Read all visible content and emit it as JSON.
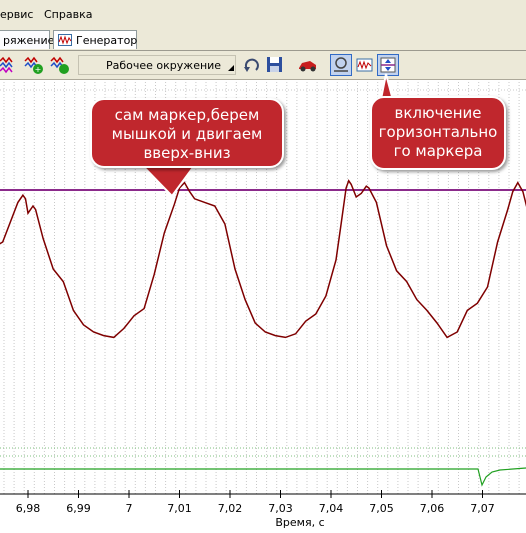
{
  "menu": {
    "items": [
      "ервис",
      "Справка"
    ]
  },
  "tabs": [
    {
      "label": "ряжение"
    },
    {
      "label": "Генератор"
    }
  ],
  "toolbar": {
    "environment_select": "Рабочее окружение",
    "icons": [
      "multiwave-red-icon",
      "multiwave-green-icon",
      "multiwave-green-icon",
      "dropdown-arrow-icon",
      "undo-icon",
      "save-icon",
      "car-icon",
      "reset-view-icon",
      "waveform-view-icon",
      "horizontal-marker-icon"
    ]
  },
  "chart_data": {
    "type": "line",
    "x_tick_labels": [
      "6,98",
      "6,99",
      "7",
      "7,01",
      "7,02",
      "7,03",
      "7,04",
      "7,05",
      "7,06",
      "7,07",
      "7"
    ],
    "xlabel": "Время, с",
    "horizontal_marker": true,
    "series": [
      {
        "color": "#7f0000",
        "points": [
          [
            6.972,
            0.55
          ],
          [
            6.975,
            0.6
          ],
          [
            6.978,
            0.82
          ],
          [
            6.979,
            0.86
          ],
          [
            6.9795,
            0.84
          ],
          [
            6.98,
            0.76
          ],
          [
            6.981,
            0.8
          ],
          [
            6.9815,
            0.78
          ],
          [
            6.983,
            0.62
          ],
          [
            6.985,
            0.45
          ],
          [
            6.987,
            0.38
          ],
          [
            6.989,
            0.22
          ],
          [
            6.991,
            0.14
          ],
          [
            6.993,
            0.1
          ],
          [
            6.995,
            0.08
          ],
          [
            6.997,
            0.07
          ],
          [
            6.999,
            0.12
          ],
          [
            7.001,
            0.19
          ],
          [
            7.003,
            0.23
          ],
          [
            7.005,
            0.42
          ],
          [
            7.007,
            0.65
          ],
          [
            7.009,
            0.81
          ],
          [
            7.01,
            0.9
          ],
          [
            7.011,
            0.93
          ],
          [
            7.012,
            0.88
          ],
          [
            7.013,
            0.84
          ],
          [
            7.015,
            0.82
          ],
          [
            7.017,
            0.8
          ],
          [
            7.019,
            0.7
          ],
          [
            7.021,
            0.45
          ],
          [
            7.023,
            0.28
          ],
          [
            7.025,
            0.15
          ],
          [
            7.027,
            0.1
          ],
          [
            7.029,
            0.08
          ],
          [
            7.031,
            0.07
          ],
          [
            7.033,
            0.09
          ],
          [
            7.035,
            0.16
          ],
          [
            7.037,
            0.2
          ],
          [
            7.039,
            0.3
          ],
          [
            7.041,
            0.5
          ],
          [
            7.042,
            0.7
          ],
          [
            7.043,
            0.9
          ],
          [
            7.0435,
            0.94
          ],
          [
            7.044,
            0.92
          ],
          [
            7.045,
            0.85
          ],
          [
            7.046,
            0.87
          ],
          [
            7.047,
            0.91
          ],
          [
            7.0475,
            0.9
          ],
          [
            7.049,
            0.82
          ],
          [
            7.051,
            0.58
          ],
          [
            7.053,
            0.44
          ],
          [
            7.055,
            0.38
          ],
          [
            7.057,
            0.28
          ],
          [
            7.059,
            0.22
          ],
          [
            7.061,
            0.15
          ],
          [
            7.063,
            0.07
          ],
          [
            7.065,
            0.1
          ],
          [
            7.067,
            0.22
          ],
          [
            7.069,
            0.26
          ],
          [
            7.071,
            0.35
          ],
          [
            7.073,
            0.6
          ],
          [
            7.075,
            0.78
          ],
          [
            7.076,
            0.88
          ],
          [
            7.077,
            0.93
          ],
          [
            7.078,
            0.88
          ],
          [
            7.079,
            0.77
          ]
        ]
      },
      {
        "color": "#00a000",
        "points": []
      }
    ]
  },
  "callouts": {
    "marker_hint": "сам маркер,берем мышкой и двигаем вверх-вниз",
    "toggle_hint": "включение горизонтально го маркера"
  },
  "colors": {
    "marker_line": "#8b2a8b",
    "signal": "#7f0000",
    "secondary_signal": "#22a022",
    "callout_bg": "#c0272d"
  }
}
